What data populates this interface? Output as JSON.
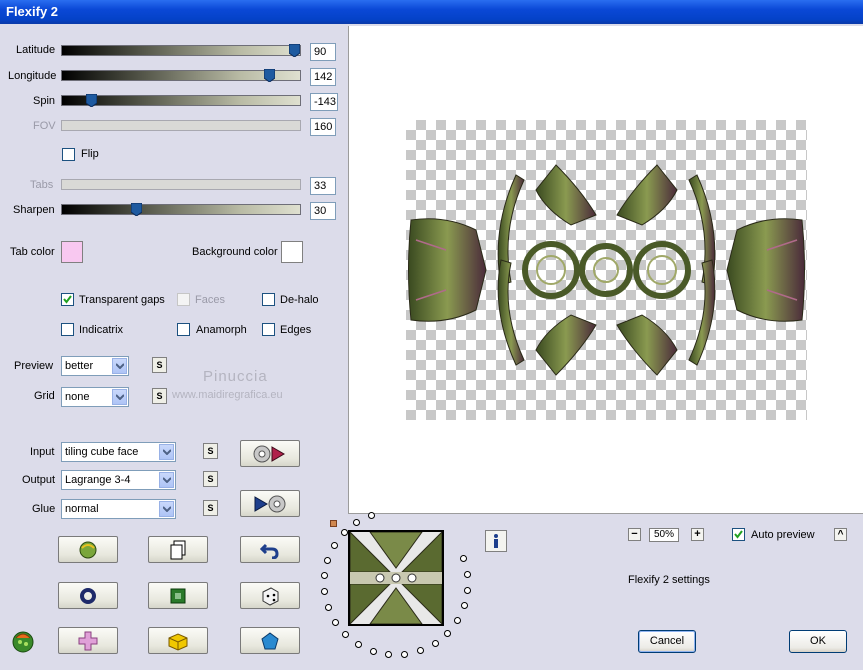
{
  "window": {
    "title": "Flexify 2"
  },
  "sliders": [
    {
      "label": "Latitude",
      "value": "90",
      "level": 0.975,
      "enabled": true
    },
    {
      "label": "Longitude",
      "value": "142",
      "level": 0.87,
      "enabled": true
    },
    {
      "label": "Spin",
      "value": "-143",
      "level": 0.12,
      "enabled": true
    },
    {
      "label": "FOV",
      "value": "160",
      "level": null,
      "enabled": false
    }
  ],
  "flip": {
    "label": "Flip",
    "checked": false
  },
  "tabs_slider": {
    "label": "Tabs",
    "value": "33",
    "enabled": false
  },
  "sharpen_slider": {
    "label": "Sharpen",
    "value": "30",
    "level": 0.31,
    "enabled": true
  },
  "colors": {
    "tab_label": "Tab color",
    "tab_value": "#f8c8f0",
    "bg_label": "Background color",
    "bg_value": "#ffffff"
  },
  "options": {
    "transparent_gaps": {
      "label": "Transparent gaps",
      "checked": true
    },
    "faces": {
      "label": "Faces",
      "checked": false,
      "enabled": false
    },
    "de_halo": {
      "label": "De-halo",
      "checked": false
    },
    "indicatrix": {
      "label": "Indicatrix",
      "checked": false
    },
    "anamorph": {
      "label": "Anamorph",
      "checked": false
    },
    "edges": {
      "label": "Edges",
      "checked": false
    }
  },
  "preview": {
    "label": "Preview",
    "value": "better"
  },
  "grid": {
    "label": "Grid",
    "value": "none"
  },
  "watermark": {
    "line1": "Pinuccia",
    "line2": "www.maidiregrafica.eu"
  },
  "input": {
    "label": "Input",
    "value": "tiling cube face"
  },
  "output": {
    "label": "Output",
    "value": "Lagrange 3-4"
  },
  "glue": {
    "label": "Glue",
    "value": "normal"
  },
  "s_button_label": "S",
  "zoom": {
    "value": "50%",
    "minus": "−",
    "plus": "+"
  },
  "auto_preview": {
    "label": "Auto preview",
    "checked": true,
    "caret": "^"
  },
  "settings_caption": "Flexify 2 settings",
  "buttons": {
    "cancel": "Cancel",
    "ok": "OK"
  },
  "accent_colors": {
    "titlebar": "#0a48d6",
    "dialog": "#dcdcea",
    "thumb": "#1e5aa0"
  }
}
